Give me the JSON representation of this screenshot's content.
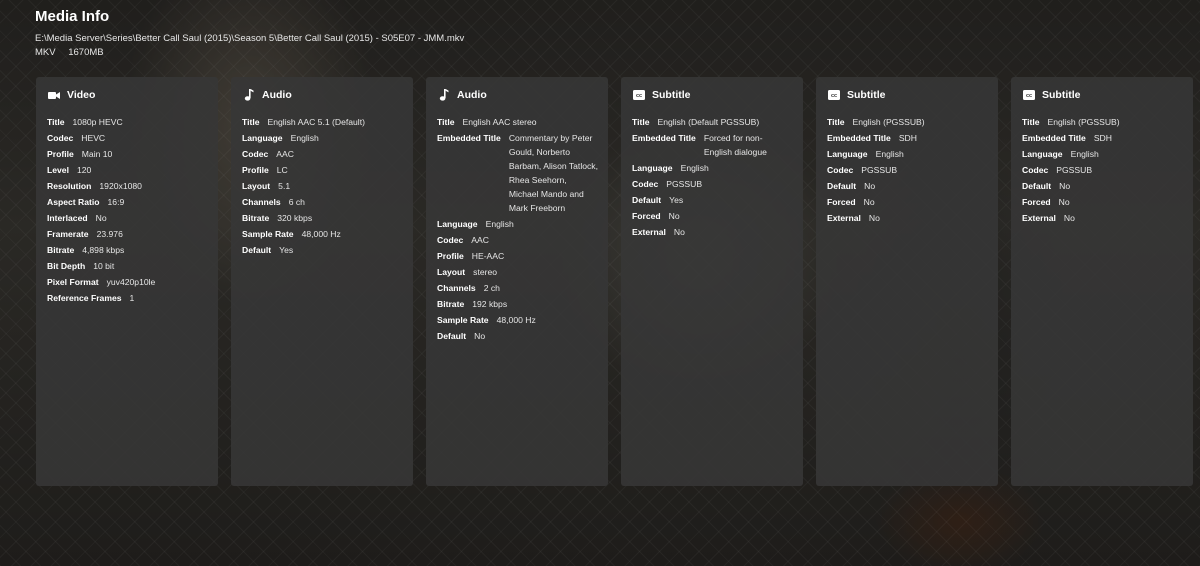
{
  "page": {
    "title": "Media Info",
    "path": "E:\\Media Server\\Series\\Better Call Saul (2015)\\Season 5\\Better Call Saul (2015) - S05E07 - JMM.mkv",
    "container": "MKV",
    "size": "1670MB"
  },
  "streams": [
    {
      "type": "Video",
      "icon": "video-camera-icon",
      "rows": [
        {
          "k": "Title",
          "v": "1080p HEVC"
        },
        {
          "k": "Codec",
          "v": "HEVC"
        },
        {
          "k": "Profile",
          "v": "Main 10"
        },
        {
          "k": "Level",
          "v": "120"
        },
        {
          "k": "Resolution",
          "v": "1920x1080"
        },
        {
          "k": "Aspect Ratio",
          "v": "16:9"
        },
        {
          "k": "Interlaced",
          "v": "No"
        },
        {
          "k": "Framerate",
          "v": "23.976"
        },
        {
          "k": "Bitrate",
          "v": "4,898 kbps"
        },
        {
          "k": "Bit Depth",
          "v": "10 bit"
        },
        {
          "k": "Pixel Format",
          "v": "yuv420p10le"
        },
        {
          "k": "Reference Frames",
          "v": "1"
        }
      ]
    },
    {
      "type": "Audio",
      "icon": "music-note-icon",
      "rows": [
        {
          "k": "Title",
          "v": "English AAC 5.1 (Default)"
        },
        {
          "k": "Language",
          "v": "English"
        },
        {
          "k": "Codec",
          "v": "AAC"
        },
        {
          "k": "Profile",
          "v": "LC"
        },
        {
          "k": "Layout",
          "v": "5.1"
        },
        {
          "k": "Channels",
          "v": "6 ch"
        },
        {
          "k": "Bitrate",
          "v": "320 kbps"
        },
        {
          "k": "Sample Rate",
          "v": "48,000 Hz"
        },
        {
          "k": "Default",
          "v": "Yes"
        }
      ]
    },
    {
      "type": "Audio",
      "icon": "music-note-icon",
      "rows": [
        {
          "k": "Title",
          "v": "English AAC stereo"
        },
        {
          "k": "Embedded Title",
          "v": "Commentary by Peter Gould, Norberto Barbam, Alison Tatlock, Rhea Seehorn, Michael Mando and Mark Freeborn"
        },
        {
          "k": "Language",
          "v": "English"
        },
        {
          "k": "Codec",
          "v": "AAC"
        },
        {
          "k": "Profile",
          "v": "HE-AAC"
        },
        {
          "k": "Layout",
          "v": "stereo"
        },
        {
          "k": "Channels",
          "v": "2 ch"
        },
        {
          "k": "Bitrate",
          "v": "192 kbps"
        },
        {
          "k": "Sample Rate",
          "v": "48,000 Hz"
        },
        {
          "k": "Default",
          "v": "No"
        }
      ]
    },
    {
      "type": "Subtitle",
      "icon": "closed-caption-icon",
      "rows": [
        {
          "k": "Title",
          "v": "English (Default PGSSUB)"
        },
        {
          "k": "Embedded Title",
          "v": "Forced for non-English dialogue"
        },
        {
          "k": "Language",
          "v": "English"
        },
        {
          "k": "Codec",
          "v": "PGSSUB"
        },
        {
          "k": "Default",
          "v": "Yes"
        },
        {
          "k": "Forced",
          "v": "No"
        },
        {
          "k": "External",
          "v": "No"
        }
      ]
    },
    {
      "type": "Subtitle",
      "icon": "closed-caption-icon",
      "rows": [
        {
          "k": "Title",
          "v": "English (PGSSUB)"
        },
        {
          "k": "Embedded Title",
          "v": "SDH"
        },
        {
          "k": "Language",
          "v": "English"
        },
        {
          "k": "Codec",
          "v": "PGSSUB"
        },
        {
          "k": "Default",
          "v": "No"
        },
        {
          "k": "Forced",
          "v": "No"
        },
        {
          "k": "External",
          "v": "No"
        }
      ]
    },
    {
      "type": "Subtitle",
      "icon": "closed-caption-icon",
      "rows": [
        {
          "k": "Title",
          "v": "English (PGSSUB)"
        },
        {
          "k": "Embedded Title",
          "v": "SDH"
        },
        {
          "k": "Language",
          "v": "English"
        },
        {
          "k": "Codec",
          "v": "PGSSUB"
        },
        {
          "k": "Default",
          "v": "No"
        },
        {
          "k": "Forced",
          "v": "No"
        },
        {
          "k": "External",
          "v": "No"
        }
      ]
    }
  ]
}
